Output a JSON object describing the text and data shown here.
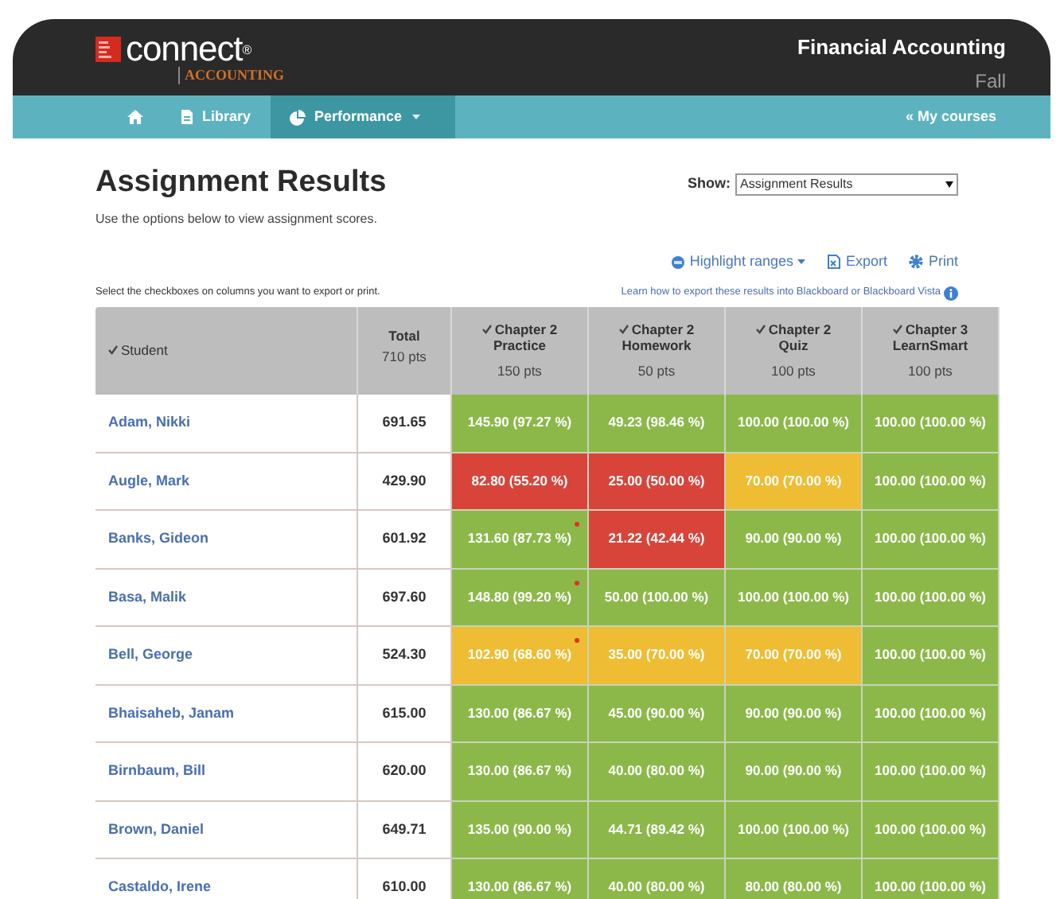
{
  "header": {
    "logo_word": "connect",
    "logo_mark": "®",
    "logo_subject": "ACCOUNTING",
    "course_title": "Financial Accounting",
    "term": "Fall"
  },
  "nav": {
    "items": [
      {
        "kind": "home",
        "selected": false
      },
      {
        "kind": "library",
        "label": "Library",
        "selected": false
      },
      {
        "kind": "performance",
        "label": "Performance",
        "selected": true
      }
    ],
    "my_courses": "« My courses"
  },
  "page": {
    "title": "Assignment Results",
    "subtitle": "Use the options below to view assignment scores.",
    "show_label": "Show:",
    "show_value": "Assignment Results"
  },
  "actions": [
    {
      "kind": "highlight",
      "label": "Highlight ranges"
    },
    {
      "kind": "export",
      "label": "Export"
    },
    {
      "kind": "print",
      "label": "Print"
    }
  ],
  "hint": "Select the checkboxes on columns you want to export or print.",
  "learn_link": "Learn how to export these results into Blackboard or Blackboard Vista",
  "table": {
    "columns": [
      {
        "title": "Student",
        "checked": true
      },
      {
        "title": "Total",
        "points": "710 pts"
      },
      {
        "title": "Chapter 2 Practice",
        "points": "150 pts",
        "checked": true
      },
      {
        "title": "Chapter 2 Homework",
        "points": "50 pts",
        "checked": true
      },
      {
        "title": "Chapter 2 Quiz",
        "points": "100 pts",
        "checked": true
      },
      {
        "title": "Chapter 3 LearnSmart",
        "points": "100 pts",
        "checked": true
      }
    ],
    "rows": [
      {
        "student": "Adam, Nikki",
        "total": "691.65",
        "scores": [
          {
            "text": "145.90 (97.27 %)",
            "color": "#8cb84a",
            "flag": false
          },
          {
            "text": "49.23 (98.46 %)",
            "color": "#8cb84a",
            "flag": false
          },
          {
            "text": "100.00 (100.00 %)",
            "color": "#8cb84a",
            "flag": false
          },
          {
            "text": "100.00 (100.00 %)",
            "color": "#8cb84a",
            "flag": false
          }
        ]
      },
      {
        "student": "Augle, Mark",
        "total": "429.90",
        "scores": [
          {
            "text": "82.80 (55.20 %)",
            "color": "#d8443a",
            "flag": false
          },
          {
            "text": "25.00 (50.00 %)",
            "color": "#d8443a",
            "flag": false
          },
          {
            "text": "70.00 (70.00 %)",
            "color": "#eebd33",
            "flag": false
          },
          {
            "text": "100.00 (100.00 %)",
            "color": "#8cb84a",
            "flag": false
          }
        ]
      },
      {
        "student": "Banks, Gideon",
        "total": "601.92",
        "scores": [
          {
            "text": "131.60 (87.73 %)",
            "color": "#8cb84a",
            "flag": true
          },
          {
            "text": "21.22 (42.44 %)",
            "color": "#d8443a",
            "flag": false
          },
          {
            "text": "90.00 (90.00 %)",
            "color": "#8cb84a",
            "flag": false
          },
          {
            "text": "100.00 (100.00 %)",
            "color": "#8cb84a",
            "flag": false
          }
        ]
      },
      {
        "student": "Basa, Malik",
        "total": "697.60",
        "scores": [
          {
            "text": "148.80 (99.20 %)",
            "color": "#8cb84a",
            "flag": true
          },
          {
            "text": "50.00 (100.00 %)",
            "color": "#8cb84a",
            "flag": false
          },
          {
            "text": "100.00 (100.00 %)",
            "color": "#8cb84a",
            "flag": false
          },
          {
            "text": "100.00 (100.00 %)",
            "color": "#8cb84a",
            "flag": false
          }
        ]
      },
      {
        "student": "Bell, George",
        "total": "524.30",
        "scores": [
          {
            "text": "102.90 (68.60 %)",
            "color": "#eebd33",
            "flag": true
          },
          {
            "text": "35.00 (70.00 %)",
            "color": "#eebd33",
            "flag": false
          },
          {
            "text": "70.00 (70.00 %)",
            "color": "#eebd33",
            "flag": false
          },
          {
            "text": "100.00 (100.00 %)",
            "color": "#8cb84a",
            "flag": false
          }
        ]
      },
      {
        "student": "Bhaisaheb, Janam",
        "total": "615.00",
        "scores": [
          {
            "text": "130.00 (86.67 %)",
            "color": "#8cb84a",
            "flag": false
          },
          {
            "text": "45.00 (90.00 %)",
            "color": "#8cb84a",
            "flag": false
          },
          {
            "text": "90.00 (90.00 %)",
            "color": "#8cb84a",
            "flag": false
          },
          {
            "text": "100.00 (100.00 %)",
            "color": "#8cb84a",
            "flag": false
          }
        ]
      },
      {
        "student": "Birnbaum, Bill",
        "total": "620.00",
        "scores": [
          {
            "text": "130.00 (86.67 %)",
            "color": "#8cb84a",
            "flag": false
          },
          {
            "text": "40.00 (80.00 %)",
            "color": "#8cb84a",
            "flag": false
          },
          {
            "text": "90.00 (90.00 %)",
            "color": "#8cb84a",
            "flag": false
          },
          {
            "text": "100.00 (100.00 %)",
            "color": "#8cb84a",
            "flag": false
          }
        ]
      },
      {
        "student": "Brown, Daniel",
        "total": "649.71",
        "scores": [
          {
            "text": "135.00 (90.00 %)",
            "color": "#8cb84a",
            "flag": false
          },
          {
            "text": "44.71 (89.42 %)",
            "color": "#8cb84a",
            "flag": false
          },
          {
            "text": "100.00 (100.00 %)",
            "color": "#8cb84a",
            "flag": false
          },
          {
            "text": "100.00 (100.00 %)",
            "color": "#8cb84a",
            "flag": false
          }
        ]
      },
      {
        "student": "Castaldo, Irene",
        "total": "610.00",
        "scores": [
          {
            "text": "130.00 (86.67 %)",
            "color": "#8cb84a",
            "flag": false
          },
          {
            "text": "40.00 (80.00 %)",
            "color": "#8cb84a",
            "flag": false
          },
          {
            "text": "80.00 (80.00 %)",
            "color": "#8cb84a",
            "flag": false
          },
          {
            "text": "100.00 (100.00 %)",
            "color": "#8cb84a",
            "flag": false
          }
        ]
      }
    ]
  }
}
